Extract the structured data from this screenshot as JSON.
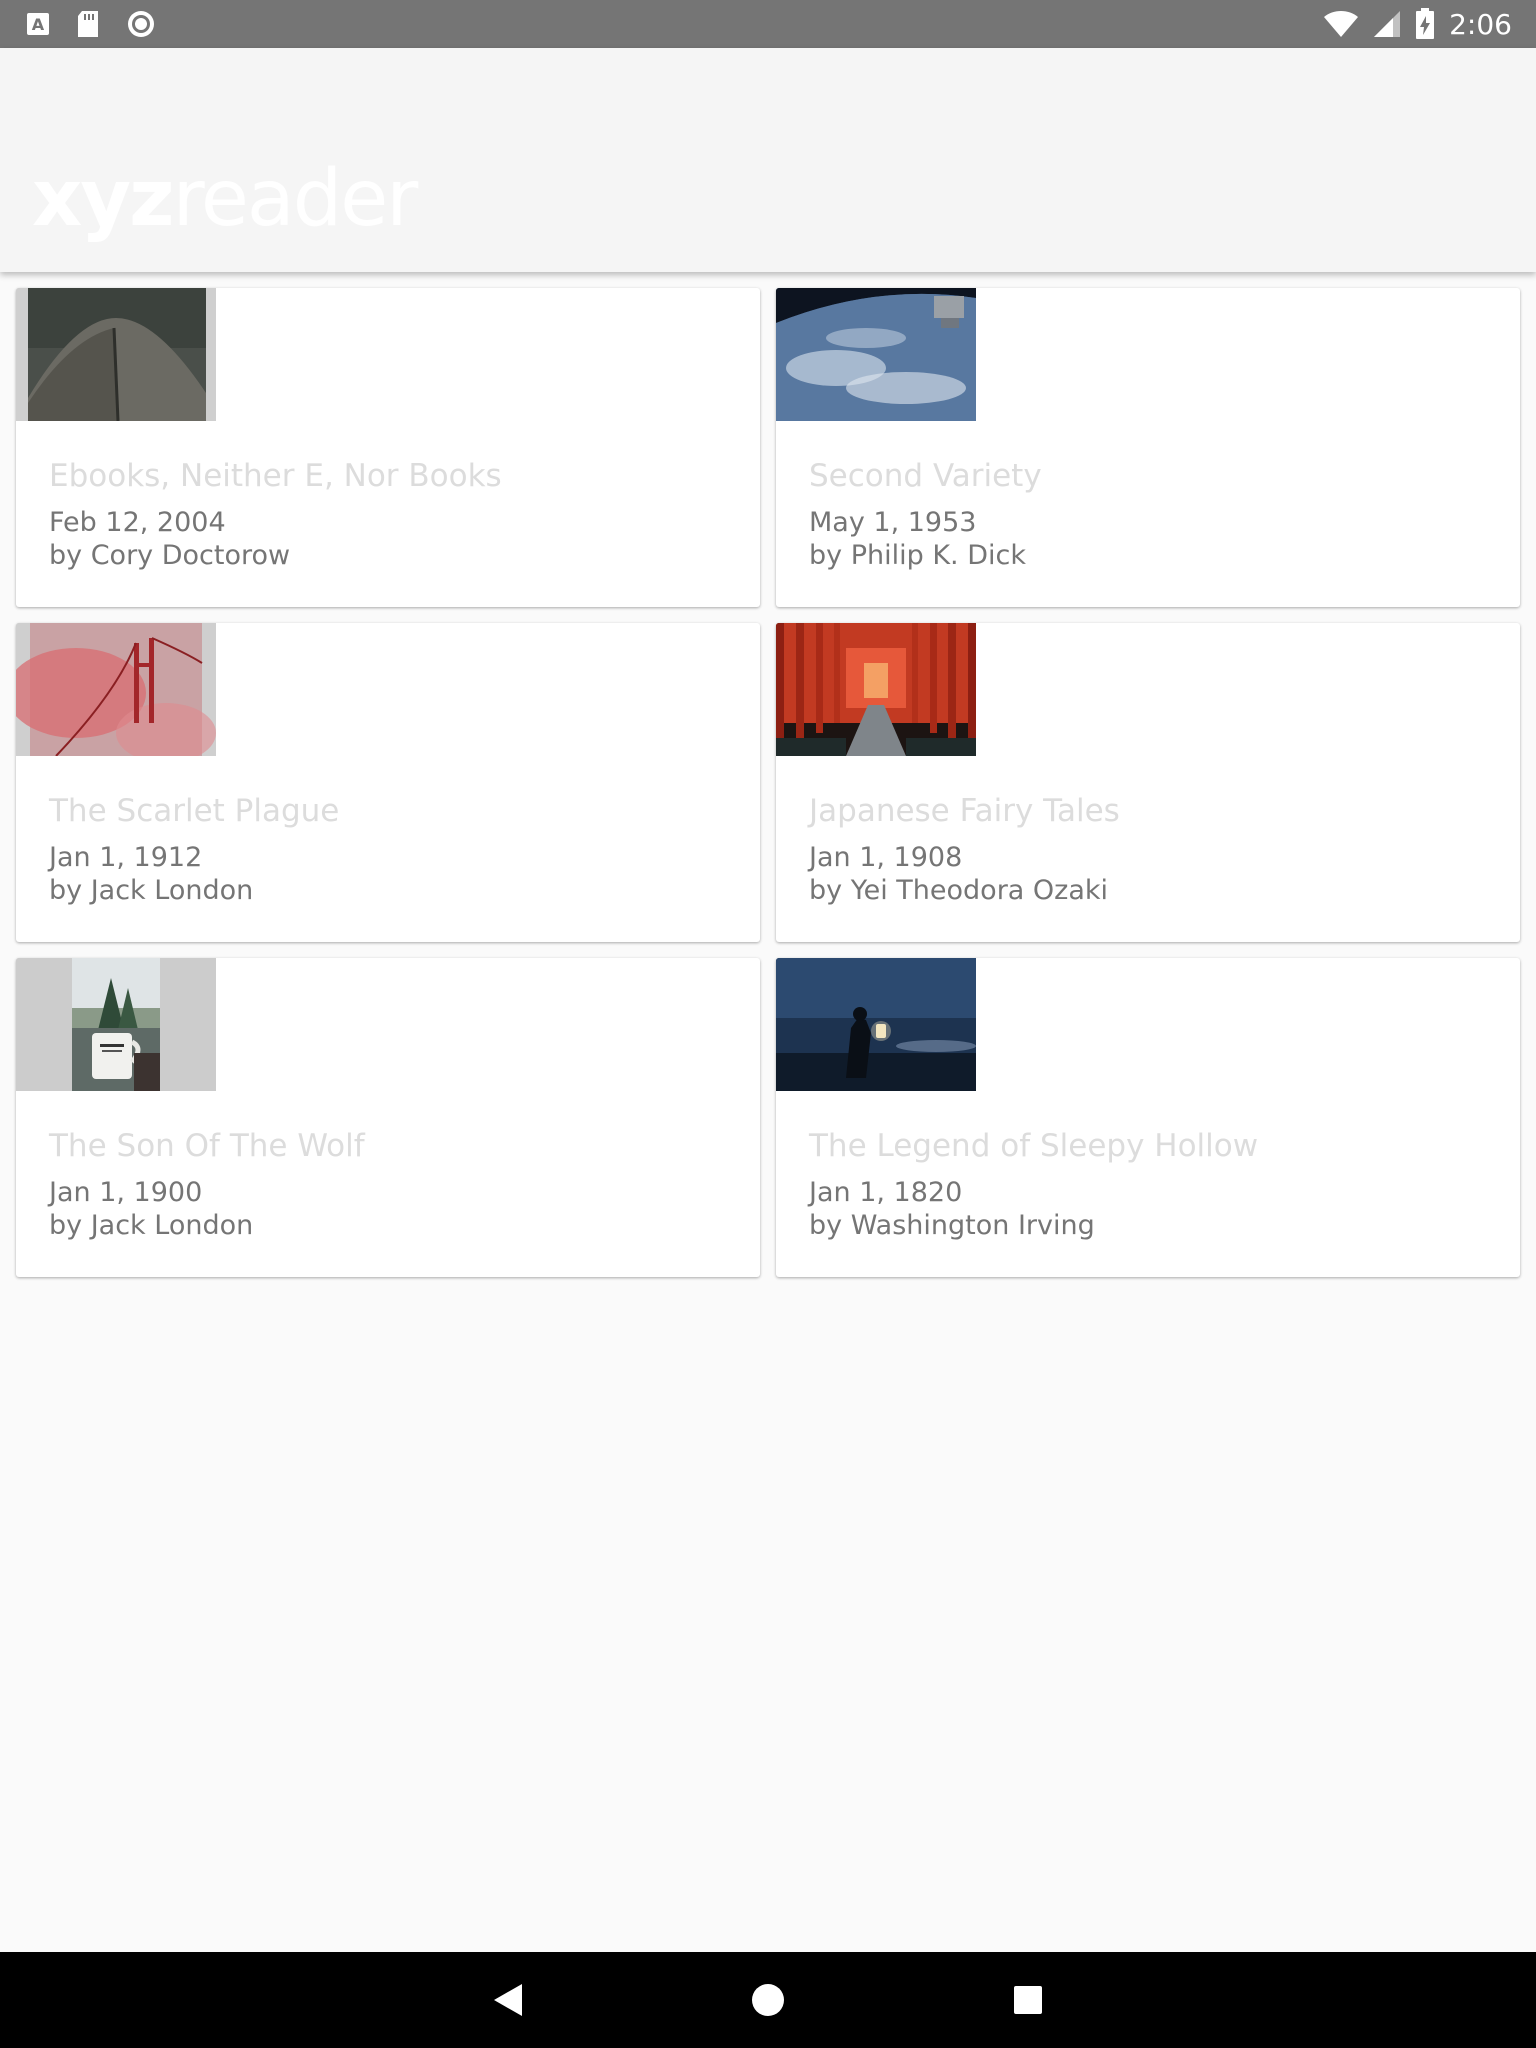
{
  "status_bar": {
    "time": "2:06",
    "left_icons": [
      "a-font-icon",
      "sd-card-icon",
      "sync-circle-icon"
    ],
    "right_icons": [
      "wifi-icon",
      "cell-signal-icon",
      "battery-charging-icon"
    ]
  },
  "app_bar": {
    "logo_bold": "xyz",
    "logo_light": "reader"
  },
  "articles": [
    {
      "title": "Ebooks, Neither E, Nor Books",
      "date": "Feb 12, 2004",
      "author": "by Cory Doctorow",
      "thumb": "dark-curved-roof-photo"
    },
    {
      "title": "Second Variety",
      "date": "May 1, 1953",
      "author": "by Philip K. Dick",
      "thumb": "earth-from-space-photo"
    },
    {
      "title": "The Scarlet Plague",
      "date": "Jan 1, 1912",
      "author": "by Jack London",
      "thumb": "red-bridge-in-fog-photo"
    },
    {
      "title": "Japanese Fairy Tales",
      "date": "Jan 1, 1908",
      "author": "by Yei Theodora Ozaki",
      "thumb": "red-torii-gates-photo"
    },
    {
      "title": "The Son Of The Wolf",
      "date": "Jan 1, 1900",
      "author": "by Jack London",
      "thumb": "camping-mug-photo"
    },
    {
      "title": "The Legend of Sleepy Hollow",
      "date": "Jan 1, 1820",
      "author": "by Washington Irving",
      "thumb": "person-with-lantern-photo"
    }
  ],
  "nav_bar": {
    "buttons": [
      "back-icon",
      "home-icon",
      "recents-icon"
    ]
  },
  "colors": {
    "status_bar": "#757575",
    "app_bar": "#f5f5f5",
    "background": "#fafafa",
    "title_text": "#dcdcdc",
    "meta_text": "#757575"
  }
}
